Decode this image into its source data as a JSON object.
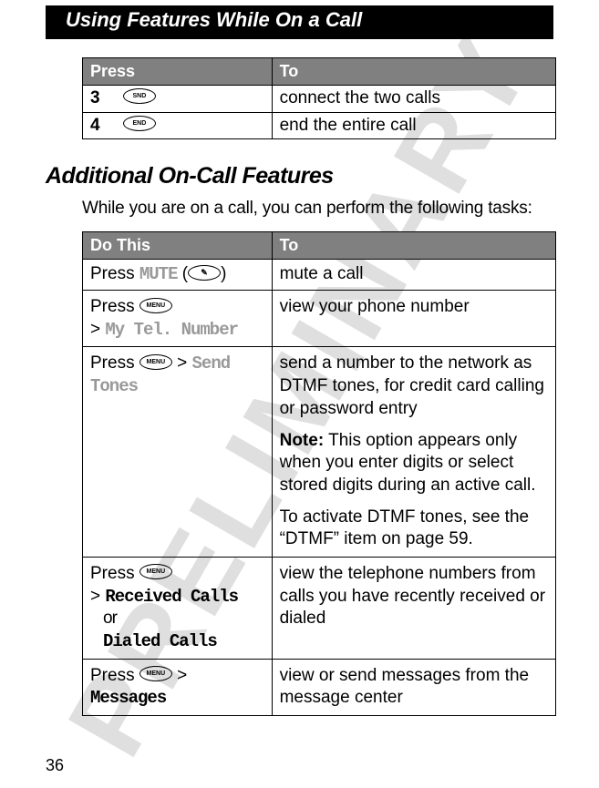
{
  "chapter_title": "Using Features While On a Call",
  "watermark": "PRELIMINARY",
  "page_number": "36",
  "table1": {
    "headers": {
      "col1": "Press",
      "col2": "To"
    },
    "rows": [
      {
        "step": "3",
        "key": "SND",
        "desc": "connect the two calls"
      },
      {
        "step": "4",
        "key": "END",
        "desc": "end the entire call"
      }
    ]
  },
  "section_title": "Additional On-Call Features",
  "intro_text": "While you are on a call, you can perform the following tasks:",
  "table2": {
    "headers": {
      "col1": "Do This",
      "col2": "To"
    },
    "rows": [
      {
        "press": "Press ",
        "menu_text": "MUTE",
        "paren_open": " (",
        "key": "✎",
        "paren_close": ")",
        "desc": "mute a call"
      },
      {
        "press": "Press ",
        "key": "MENU",
        "gt": " > ",
        "menu_text": "My Tel. Number",
        "desc": "view your phone number"
      },
      {
        "press": "Press ",
        "key": "MENU",
        "gt": " > ",
        "menu_text": "Send Tones",
        "desc1": "send a number to the network as DTMF tones, for credit card calling or password entry",
        "note_label": "Note:",
        "note_text": " This option appears only when you enter digits or select stored digits during an active call.",
        "desc2": "To activate DTMF tones, see the “DTMF” item on page 59."
      },
      {
        "press": "Press ",
        "key": "MENU",
        "gt": " > ",
        "menu_text1": "Received Calls",
        "or_text": "or",
        "menu_text2": "Dialed Calls",
        "desc": "view the telephone numbers from calls you have recently received or dialed"
      },
      {
        "press": "Press ",
        "key": "MENU",
        "gt": " > ",
        "menu_text": "Messages",
        "desc": "view or send messages from the message center"
      }
    ]
  }
}
